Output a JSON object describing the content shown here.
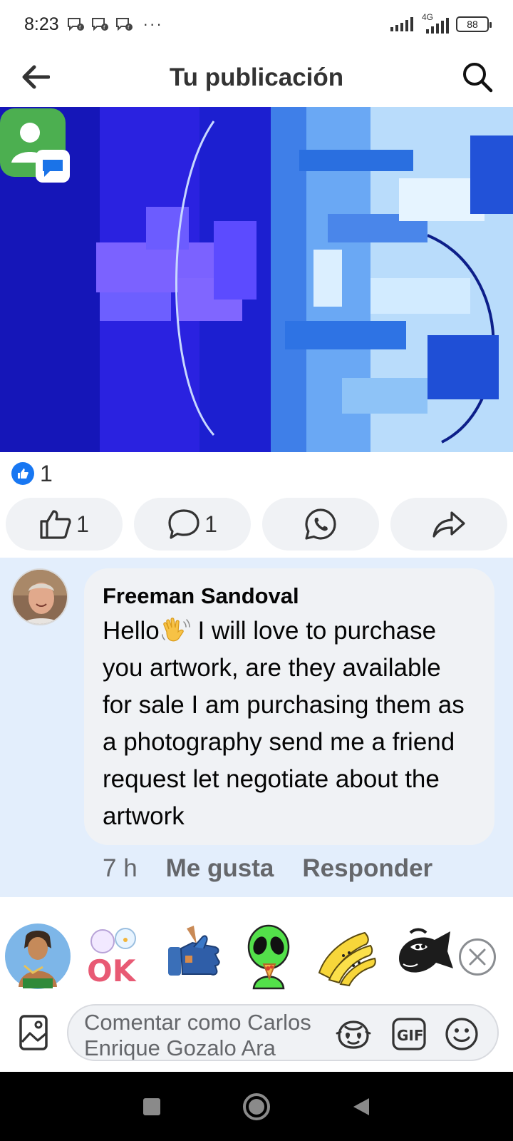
{
  "status_bar": {
    "time": "8:23",
    "more": "···",
    "network": "4G",
    "battery": "88"
  },
  "header": {
    "title": "Tu publicación",
    "back_icon": "arrow-left-icon",
    "search_icon": "search-icon"
  },
  "reactions": {
    "icon": "like-badge-icon",
    "count": "1"
  },
  "actions": [
    {
      "icon": "thumbs-up-icon",
      "count": "1"
    },
    {
      "icon": "comment-icon",
      "count": "1"
    },
    {
      "icon": "whatsapp-icon",
      "count": ""
    },
    {
      "icon": "share-icon",
      "count": ""
    }
  ],
  "comment": {
    "author": "Freeman Sandoval",
    "text_before_emoji": "Hello",
    "text_after_emoji": " I will love to purchase you artwork, are they available for sale I am purchasing them as a photography send me a friend request let negotiate about the artwork",
    "emoji": "waving-hand",
    "time": "7 h",
    "like_label": "Me gusta",
    "reply_label": "Responder"
  },
  "stickers": [
    "warrior-sticker",
    "ok-sticker",
    "thumbs-up-robot-sticker",
    "alien-pizza-sticker",
    "bananas-sticker",
    "fish-sticker"
  ],
  "composer": {
    "placeholder": "Comentar como Carlos Enrique Gozalo Ara",
    "icons": [
      "photo-icon",
      "avatar-sticker-icon",
      "gif-icon",
      "emoji-icon"
    ]
  },
  "colors": {
    "facebook_blue": "#1877f2",
    "comment_highlight": "#e3eefc",
    "bubble": "#f0f2f5",
    "meta_gray": "#65676b"
  }
}
